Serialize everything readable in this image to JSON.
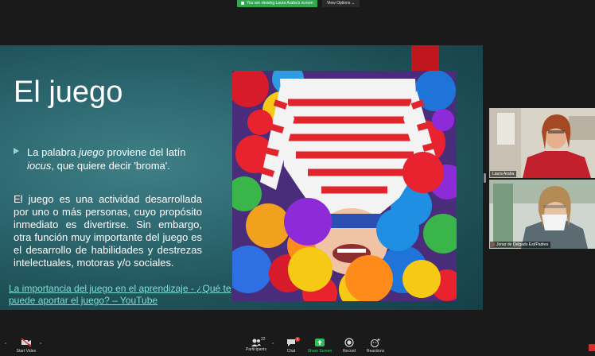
{
  "banner": {
    "sharing_text": "You are viewing Laura Araba's screen",
    "view_options": "View Options"
  },
  "slide": {
    "title": "El juego",
    "bullet": {
      "pre": "La palabra ",
      "em1": "juego",
      "mid": " proviene del latín ",
      "em2": "iocus",
      "post": ", que quiere decir 'broma'."
    },
    "paragraph": "El juego es una actividad desarrollada por uno o más personas, cuyo propósito inmediato es  divertirse. Sin embargo, otra función muy importante del juego es el desarrollo de habilidades y destrezas intelectuales, motoras y/o sociales.",
    "link": "La importancia del juego en el aprendizaje - ¿Qué te puede aportar el juego? – YouTube"
  },
  "participants_tiles": [
    {
      "name": "Laura Araba"
    },
    {
      "name": "Jonar de Delgado Est/Padres"
    }
  ],
  "toolbar": {
    "start_video": "Start Video",
    "participants": "Participants",
    "participants_count": "22",
    "chat": "Chat",
    "chat_badge": "9",
    "share_screen": "Share Screen",
    "record": "Record",
    "reactions": "Reactions"
  },
  "colors": {
    "slide_bg": "#2d6870",
    "accent_red": "#c0161e",
    "link": "#7ee0d2",
    "share_green": "#2fa84f"
  },
  "icons": [
    "video-off-icon",
    "participants-icon",
    "chat-icon",
    "share-screen-icon",
    "record-icon",
    "reactions-icon"
  ]
}
